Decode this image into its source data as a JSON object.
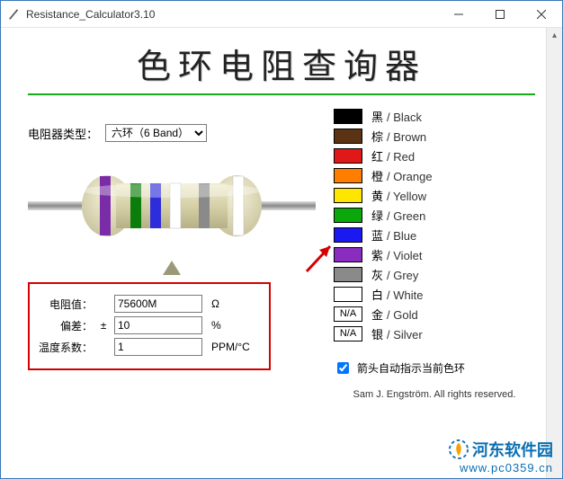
{
  "window": {
    "title": "Resistance_Calculator3.10"
  },
  "app": {
    "big_title": "色环电阻查询器",
    "type_label": "电阻器类型：",
    "type_selected": "六环（6 Band）"
  },
  "results": {
    "resistance_label": "电阻值：",
    "resistance_value": "75600M",
    "resistance_unit": "Ω",
    "tolerance_label": "偏差：",
    "tolerance_pm": "±",
    "tolerance_value": "10",
    "tolerance_unit": "%",
    "tempco_label": "温度系数：",
    "tempco_value": "1",
    "tempco_unit": "PPM/°C"
  },
  "resistor_bands": [
    {
      "color": "#7a2ca8"
    },
    {
      "color": "#0b7d0b"
    },
    {
      "color": "#2d2ddb"
    },
    {
      "color": "#ffffff"
    },
    {
      "color": "#8a8a8a"
    },
    {
      "color": "#ffffff"
    }
  ],
  "colors": [
    {
      "hex": "#000000",
      "zh": "黑",
      "en": "Black",
      "na": false
    },
    {
      "hex": "#5b3314",
      "zh": "棕",
      "en": "Brown",
      "na": false
    },
    {
      "hex": "#e01818",
      "zh": "红",
      "en": "Red",
      "na": false
    },
    {
      "hex": "#ff7e00",
      "zh": "橙",
      "en": "Orange",
      "na": false
    },
    {
      "hex": "#ffe600",
      "zh": "黄",
      "en": "Yellow",
      "na": false
    },
    {
      "hex": "#0aa80a",
      "zh": "绿",
      "en": "Green",
      "na": false
    },
    {
      "hex": "#1a1af0",
      "zh": "蓝",
      "en": "Blue",
      "na": false
    },
    {
      "hex": "#8a2cc0",
      "zh": "紫",
      "en": "Violet",
      "na": false
    },
    {
      "hex": "#8a8a8a",
      "zh": "灰",
      "en": "Grey",
      "na": false
    },
    {
      "hex": "#ffffff",
      "zh": "白",
      "en": "White",
      "na": false
    },
    {
      "hex": "",
      "zh": "金",
      "en": "Gold",
      "na": true
    },
    {
      "hex": "",
      "zh": "银",
      "en": "Silver",
      "na": true
    }
  ],
  "checkbox": {
    "checked": true,
    "label": "箭头自动指示当前色环"
  },
  "copyright": "Sam J. Engström.  All rights reserved.",
  "watermark": {
    "line1": "河东软件园",
    "line2": "www.pc0359.cn"
  }
}
